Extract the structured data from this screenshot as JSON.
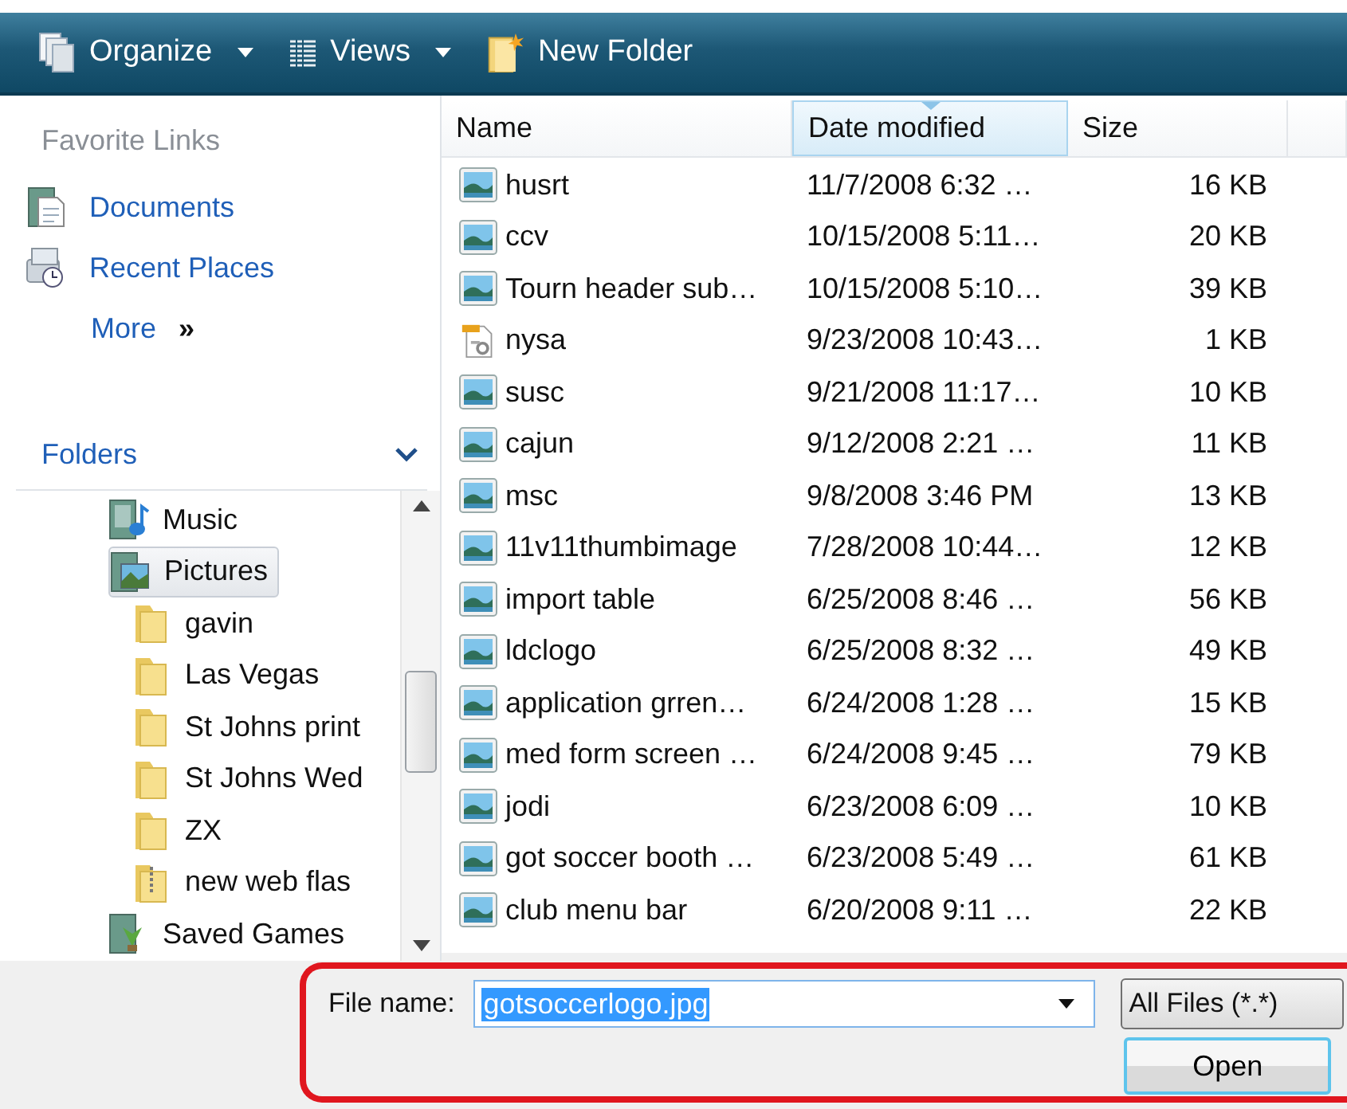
{
  "toolbar": [
    {
      "kind": "organize",
      "label": "Organize",
      "dropdown": true
    },
    {
      "kind": "views",
      "label": "Views",
      "dropdown": true
    },
    {
      "kind": "new-folder",
      "label": "New Folder",
      "dropdown": false
    }
  ],
  "favorite_links": {
    "title": "Favorite Links",
    "items": [
      {
        "kind": "documents",
        "label": "Documents"
      },
      {
        "kind": "recent",
        "label": "Recent Places"
      },
      {
        "kind": "more",
        "label": "More",
        "chevron": "»"
      }
    ]
  },
  "folders": {
    "title": "Folders",
    "expanded": true,
    "tree": [
      {
        "kind": "music",
        "label": "Music",
        "selected": false
      },
      {
        "kind": "pictures",
        "label": "Pictures",
        "selected": true,
        "children": [
          {
            "kind": "folder",
            "label": "gavin",
            "selected": false
          },
          {
            "kind": "folder",
            "label": "Las Vegas",
            "selected": false
          },
          {
            "kind": "folder",
            "label": "St Johns print",
            "selected": false
          },
          {
            "kind": "folder",
            "label": "St Johns Wed",
            "selected": false
          },
          {
            "kind": "folder",
            "label": "ZX",
            "selected": false
          },
          {
            "kind": "zip",
            "label": "new web flas",
            "selected": false
          }
        ]
      },
      {
        "kind": "games",
        "label": "Saved Games",
        "selected": false
      }
    ]
  },
  "file_list": {
    "columns": [
      {
        "label": "Name",
        "sorted": false
      },
      {
        "label": "Date modified",
        "sorted": true
      },
      {
        "label": "Size",
        "sorted": false
      }
    ],
    "rows": [
      {
        "kind": "image",
        "name": "husrt",
        "date": "11/7/2008 6:32 …",
        "size": "16 KB"
      },
      {
        "kind": "image",
        "name": "ccv",
        "date": "10/15/2008 5:11…",
        "size": "20 KB"
      },
      {
        "kind": "image",
        "name": "Tourn header sub…",
        "date": "10/15/2008 5:10…",
        "size": "39 KB"
      },
      {
        "kind": "script",
        "name": "nysa",
        "date": "9/23/2008 10:43…",
        "size": "1 KB"
      },
      {
        "kind": "image",
        "name": "susc",
        "date": "9/21/2008 11:17…",
        "size": "10 KB"
      },
      {
        "kind": "image",
        "name": "cajun",
        "date": "9/12/2008 2:21 …",
        "size": "11 KB"
      },
      {
        "kind": "image",
        "name": "msc",
        "date": "9/8/2008 3:46 PM",
        "size": "13 KB"
      },
      {
        "kind": "image",
        "name": "11v11thumbimage",
        "date": "7/28/2008 10:44…",
        "size": "12 KB"
      },
      {
        "kind": "image",
        "name": "import table",
        "date": "6/25/2008 8:46 …",
        "size": "56 KB"
      },
      {
        "kind": "image",
        "name": "ldclogo",
        "date": "6/25/2008 8:32 …",
        "size": "49 KB"
      },
      {
        "kind": "image",
        "name": "application grren…",
        "date": "6/24/2008 1:28 …",
        "size": "15 KB"
      },
      {
        "kind": "image",
        "name": "med form screen …",
        "date": "6/24/2008 9:45 …",
        "size": "79 KB"
      },
      {
        "kind": "image",
        "name": "jodi",
        "date": "6/23/2008 6:09 …",
        "size": "10 KB"
      },
      {
        "kind": "image",
        "name": "got soccer booth …",
        "date": "6/23/2008 5:49 …",
        "size": "61 KB"
      },
      {
        "kind": "image",
        "name": "club menu bar",
        "date": "6/20/2008 9:11 …",
        "size": "22 KB"
      }
    ]
  },
  "file_name": {
    "label": "File name:",
    "value": "gotsoccerlogo.jpg"
  },
  "file_type": {
    "value": "All Files (*.*)"
  },
  "buttons": [
    {
      "label": "Open"
    }
  ]
}
